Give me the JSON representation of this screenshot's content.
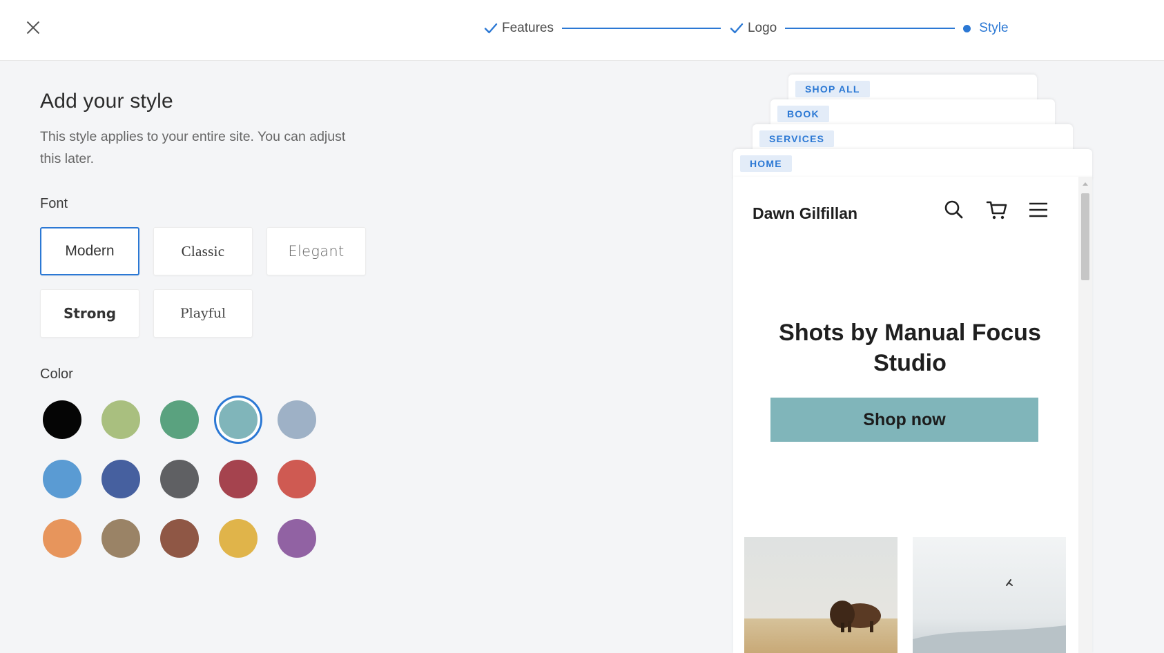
{
  "stepper": {
    "steps": [
      {
        "label": "Features",
        "state": "done"
      },
      {
        "label": "Logo",
        "state": "done"
      },
      {
        "label": "Style",
        "state": "active"
      }
    ]
  },
  "panel": {
    "title": "Add your style",
    "subtitle": "This style applies to your entire site. You can adjust this later.",
    "font_label": "Font",
    "fonts": [
      {
        "label": "Modern",
        "selected": true
      },
      {
        "label": "Classic",
        "selected": false
      },
      {
        "label": "Elegant",
        "selected": false
      },
      {
        "label": "Strong",
        "selected": false
      },
      {
        "label": "Playful",
        "selected": false
      }
    ],
    "color_label": "Color",
    "colors": [
      "#050505",
      "#a9bf7f",
      "#5aa27f",
      "#80b5ba",
      "#9eb1c6",
      "#5a9bd3",
      "#46609f",
      "#5f6063",
      "#a5434e",
      "#cf5a52",
      "#e7955c",
      "#9a8366",
      "#8f5745",
      "#e0b44a",
      "#9162a3"
    ],
    "selected_color": "#80b5ba"
  },
  "preview": {
    "tabs": [
      "SHOP ALL",
      "BOOK",
      "SERVICES",
      "HOME"
    ],
    "site_name": "Dawn Gilfillan",
    "hero_title": "Shots by Manual Focus Studio",
    "cta_label": "Shop now",
    "icons": [
      "search-icon",
      "cart-icon",
      "menu-icon"
    ]
  }
}
